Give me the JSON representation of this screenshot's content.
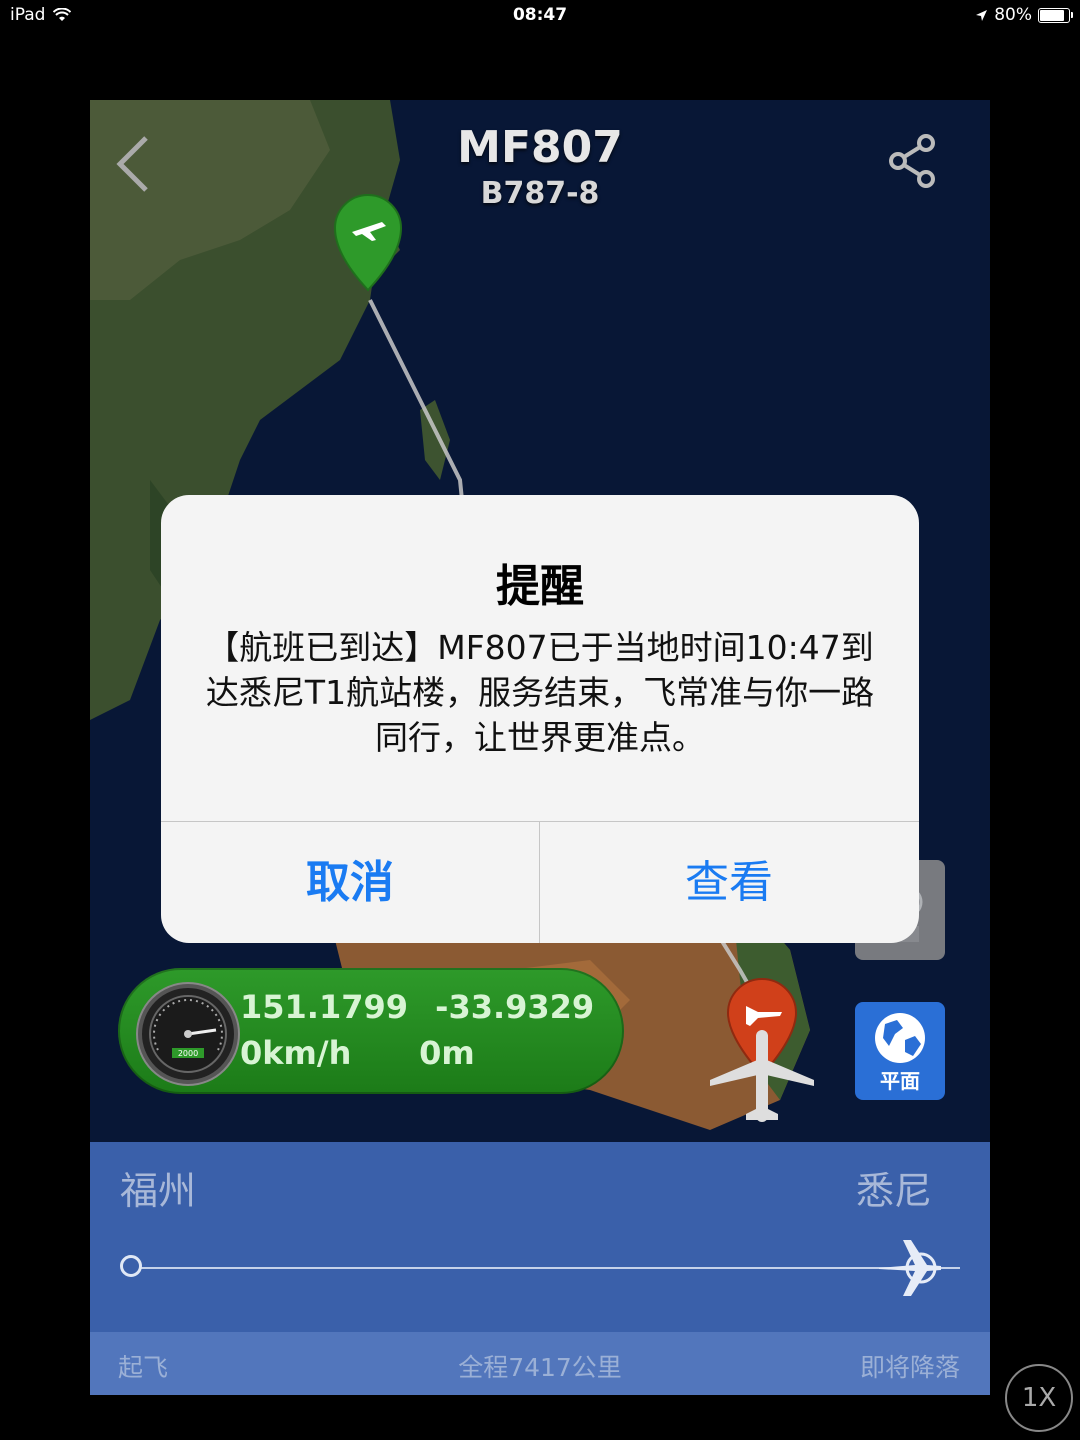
{
  "status_bar": {
    "device": "iPad",
    "time": "08:47",
    "battery": "80%",
    "battery_level": 0.8
  },
  "header": {
    "flight_number": "MF807",
    "aircraft": "B787-8"
  },
  "telemetry": {
    "longitude": "151.1799",
    "latitude": "-33.9329",
    "speed": "0km/h",
    "altitude": "0m",
    "gauge_label": "2000"
  },
  "map_controls": {
    "flat_label": "平面"
  },
  "route": {
    "origin": "福州",
    "destination": "悉尼",
    "progress": 1.0
  },
  "bottom_bar": {
    "left": "起飞",
    "center": "全程7417公里",
    "right": "即将降落"
  },
  "playback": {
    "speed": "1X"
  },
  "alert": {
    "title": "提醒",
    "message": "【航班已到达】MF807已于当地时间10:47到达悉尼T1航站楼，服务结束，飞常准与你一路同行，让世界更准点。",
    "cancel_label": "取消",
    "view_label": "查看"
  },
  "colors": {
    "origin_marker": "#2e9a2a",
    "destination_marker": "#d0401a",
    "route_panel": "#3a60aa",
    "alert_button": "#1a7bf2"
  },
  "icons": [
    "back-icon",
    "share-icon",
    "plane-icon",
    "globe-icon",
    "weather-icon",
    "wifi-icon",
    "location-icon"
  ]
}
